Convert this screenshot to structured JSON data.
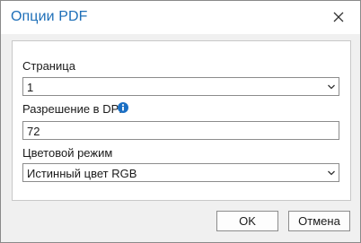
{
  "dialog": {
    "title": "Опции PDF",
    "close_icon": "close-icon"
  },
  "page_field": {
    "label": "Страница",
    "value": "1",
    "icon": "chevron-down-icon"
  },
  "dpi_field": {
    "label": "Разрешение в DPI",
    "info_icon": "info-icon",
    "value": "72"
  },
  "color_mode_field": {
    "label": "Цветовой режим",
    "value": "Истинный цвет RGB",
    "icon": "chevron-down-icon"
  },
  "buttons": {
    "ok": "OK",
    "cancel": "Отмена"
  },
  "colors": {
    "title": "#1e6fb8",
    "info_icon": "#1a6fc4",
    "background": "#f0f0f0",
    "panel": "#ffffff"
  }
}
